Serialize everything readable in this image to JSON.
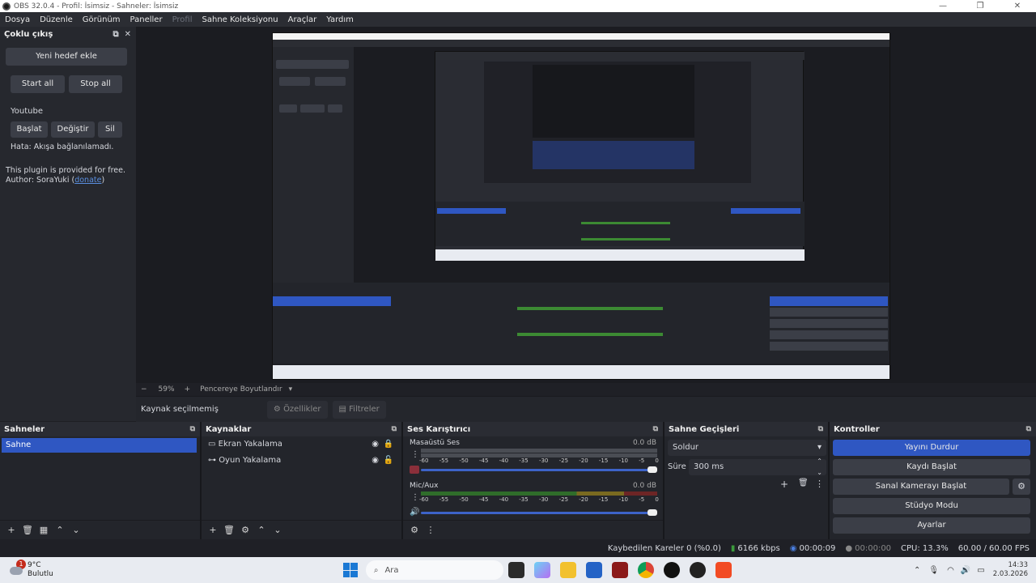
{
  "window": {
    "title": "OBS 32.0.4 - Profil: İsimsiz - Sahneler: İsimsiz"
  },
  "menu": [
    "Dosya",
    "Düzenle",
    "Görünüm",
    "Paneller",
    "Profil",
    "Sahne Koleksiyonu",
    "Araçlar",
    "Yardım"
  ],
  "multi": {
    "title": "Çoklu çıkış",
    "add_target": "Yeni hedef ekle",
    "start_all": "Start all",
    "stop_all": "Stop all",
    "target_name": "Youtube",
    "start": "Başlat",
    "edit": "Değiştir",
    "delete": "Sil",
    "error": "Hata: Akışa bağlanılamadı.",
    "free_text": "This plugin is provided for free.",
    "author_prefix": "Author: SoraYuki (",
    "donate": "donate",
    "author_suffix": ")"
  },
  "zoom": {
    "minus": "−",
    "value": "59%",
    "plus": "+",
    "fit": "Pencereye Boyutlandır"
  },
  "source_bar": {
    "none": "Kaynak seçilmemiş",
    "properties": "Özellikler",
    "filters": "Filtreler"
  },
  "scenes": {
    "title": "Sahneler",
    "items": [
      "Sahne"
    ]
  },
  "sources": {
    "title": "Kaynaklar",
    "items": [
      "Ekran Yakalama",
      "Oyun Yakalama"
    ]
  },
  "mixer": {
    "title": "Ses Karıştırıcı",
    "channels": [
      {
        "name": "Masaüstü Ses",
        "db": "0.0 dB"
      },
      {
        "name": "Mic/Aux",
        "db": "0.0 dB"
      }
    ],
    "ticks": [
      "-60",
      "-55",
      "-50",
      "-45",
      "-40",
      "-35",
      "-30",
      "-25",
      "-20",
      "-15",
      "-10",
      "-5",
      "0"
    ]
  },
  "transitions": {
    "title": "Sahne Geçişleri",
    "type": "Soldur",
    "duration_label": "Süre",
    "duration": "300 ms"
  },
  "controls": {
    "title": "Kontroller",
    "stop_stream": "Yayını Durdur",
    "start_record": "Kaydı Başlat",
    "virtual_cam": "Sanal Kamerayı Başlat",
    "studio": "Stüdyo Modu",
    "settings": "Ayarlar"
  },
  "status": {
    "dropped": "Kaybedilen Kareler 0 (%0.0)",
    "bitrate": "6166 kbps",
    "stream_time": "00:00:09",
    "rec_time": "00:00:00",
    "cpu": "CPU: 13.3%",
    "fps": "60.00 / 60.00 FPS"
  },
  "taskbar": {
    "weather_temp": "9°C",
    "weather_desc": "Bulutlu",
    "badge": "1",
    "search": "Ara",
    "time": "14:33",
    "date": "2.03.2026"
  },
  "colors": {
    "accent": "#2f57c2",
    "stop": "#c0392b",
    "meter_green": "#3c8a33",
    "meter_yellow": "#9a8a2a",
    "meter_red": "#8a2f2f"
  }
}
